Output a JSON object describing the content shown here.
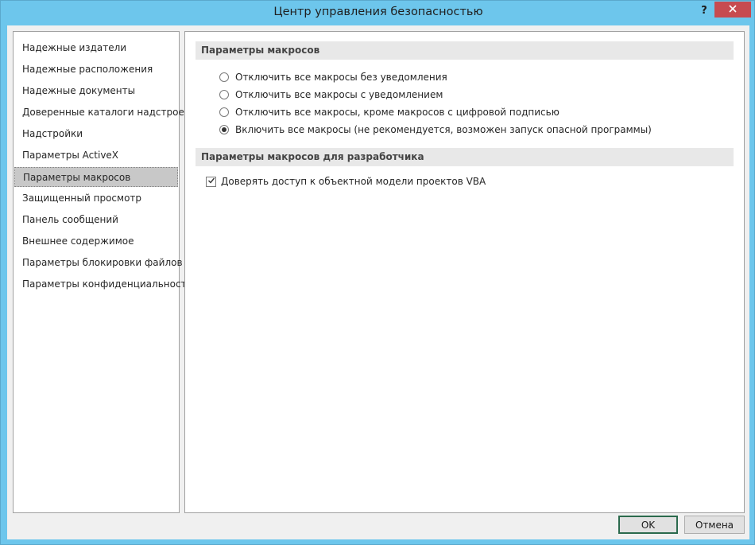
{
  "window": {
    "title": "Центр управления безопасностью",
    "help_glyph": "?",
    "close_icon": "close-icon"
  },
  "sidebar": {
    "items": [
      {
        "label": "Надежные издатели"
      },
      {
        "label": "Надежные расположения"
      },
      {
        "label": "Надежные документы"
      },
      {
        "label": "Доверенные каталоги надстроек"
      },
      {
        "label": "Надстройки"
      },
      {
        "label": "Параметры ActiveX"
      },
      {
        "label": "Параметры макросов"
      },
      {
        "label": "Защищенный просмотр"
      },
      {
        "label": "Панель сообщений"
      },
      {
        "label": "Внешнее содержимое"
      },
      {
        "label": "Параметры блокировки файлов"
      },
      {
        "label": "Параметры конфиденциальности"
      }
    ],
    "selected_index": 6
  },
  "macro_settings": {
    "heading": "Параметры макросов",
    "options": [
      {
        "label": "Отключить все макросы без уведомления",
        "selected": false
      },
      {
        "label": "Отключить все макросы с уведомлением",
        "selected": false
      },
      {
        "label": "Отключить все макросы, кроме макросов с цифровой подписью",
        "selected": false
      },
      {
        "label": "Включить все макросы (не рекомендуется, возможен запуск опасной программы)",
        "selected": true
      }
    ]
  },
  "developer_settings": {
    "heading": "Параметры макросов для разработчика",
    "trust_vba": {
      "label": "Доверять доступ к объектной модели проектов VBA",
      "checked": true
    }
  },
  "buttons": {
    "ok": "OK",
    "cancel": "Отмена"
  },
  "colors": {
    "title_bar": "#6dc6ec",
    "close_button": "#c74b50",
    "selected_item": "#c8c8c8",
    "default_button_border": "#2b6a4d"
  }
}
